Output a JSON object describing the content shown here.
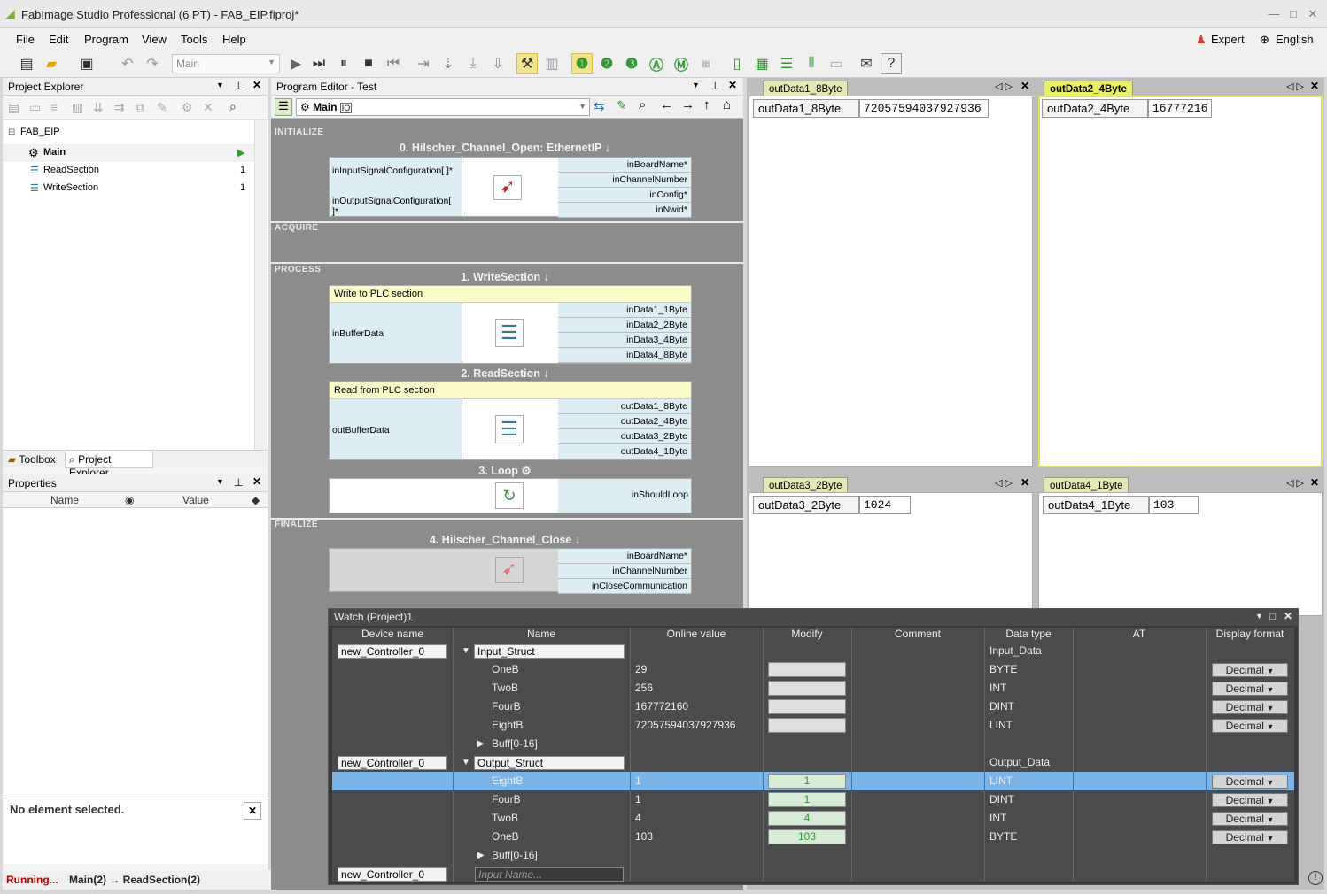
{
  "window": {
    "title": "FabImage Studio Professional (6 PT) - FAB_EIP.fiproj*"
  },
  "menu": {
    "items": [
      "File",
      "Edit",
      "Program",
      "View",
      "Tools",
      "Help"
    ],
    "expert": "Expert",
    "language": "English"
  },
  "toolbar": {
    "program_select": "Main"
  },
  "project_explorer": {
    "title": "Project Explorer",
    "root": "FAB_EIP",
    "items": [
      {
        "label": "Main",
        "count": ""
      },
      {
        "label": "ReadSection",
        "count": "1"
      },
      {
        "label": "WriteSection",
        "count": "1"
      }
    ],
    "tabs": [
      "Toolbox",
      "Project Explorer"
    ]
  },
  "properties": {
    "title": "Properties",
    "col_name": "Name",
    "col_value": "Value",
    "no_selection": "No element selected."
  },
  "status": {
    "running": "Running...",
    "path": "Main(2) → ReadSection(2)"
  },
  "program_editor": {
    "title": "Program Editor - Test",
    "program": "Main",
    "sections": {
      "initialize": "INITIALIZE",
      "acquire": "ACQUIRE",
      "process": "PROCESS",
      "finalize": "FINALIZE"
    },
    "block0": {
      "title": "0. Hilscher_Channel_Open: EthernetIP",
      "inputs": [
        "inInputSignalConfiguration[ ]*",
        "inOutputSignalConfiguration[ ]*"
      ],
      "outputs": [
        "inBoardName*",
        "inChannelNumber",
        "inConfig*",
        "inNwid*"
      ]
    },
    "block1": {
      "title": "1. WriteSection",
      "note": "Write to PLC section",
      "input": "inBufferData",
      "outputs": [
        "inData1_1Byte",
        "inData2_2Byte",
        "inData3_4Byte",
        "inData4_8Byte"
      ]
    },
    "block2": {
      "title": "2. ReadSection",
      "note": "Read from PLC section",
      "input": "outBufferData",
      "outputs": [
        "outData1_8Byte",
        "outData2_4Byte",
        "outData3_2Byte",
        "outData4_1Byte"
      ]
    },
    "block3": {
      "title": "3. Loop",
      "output": "inShouldLoop"
    },
    "block4": {
      "title": "4. Hilscher_Channel_Close",
      "outputs": [
        "inBoardName*",
        "inChannelNumber",
        "inCloseCommunication"
      ]
    }
  },
  "previews": [
    {
      "tab": "outData1_8Byte",
      "label": "outData1_8Byte",
      "value": "72057594037927936"
    },
    {
      "tab": "outData2_4Byte",
      "label": "outData2_4Byte",
      "value": "16777216"
    },
    {
      "tab": "outData3_2Byte",
      "label": "outData3_2Byte",
      "value": "1024"
    },
    {
      "tab": "outData4_1Byte",
      "label": "outData4_1Byte",
      "value": "103"
    }
  ],
  "watch": {
    "title": "Watch (Project)1",
    "columns": [
      "Device name",
      "Name",
      "Online value",
      "Modify",
      "Comment",
      "Data type",
      "AT",
      "Display format"
    ],
    "rows": [
      {
        "device": "new_Controller_0",
        "name": "Input_Struct",
        "value": "",
        "modify": "",
        "type": "Input_Data",
        "fmt": ""
      },
      {
        "device": "",
        "name": "OneB",
        "value": "29",
        "modify": "",
        "type": "BYTE",
        "fmt": "Decimal"
      },
      {
        "device": "",
        "name": "TwoB",
        "value": "256",
        "modify": "",
        "type": "INT",
        "fmt": "Decimal"
      },
      {
        "device": "",
        "name": "FourB",
        "value": "167772160",
        "modify": "",
        "type": "DINT",
        "fmt": "Decimal"
      },
      {
        "device": "",
        "name": "EightB",
        "value": "72057594037927936",
        "modify": "",
        "type": "LINT",
        "fmt": "Decimal"
      },
      {
        "device": "",
        "name": "Buff[0-16]",
        "value": "",
        "modify": "",
        "type": "",
        "fmt": ""
      },
      {
        "device": "new_Controller_0",
        "name": "Output_Struct",
        "value": "",
        "modify": "",
        "type": "Output_Data",
        "fmt": ""
      },
      {
        "device": "",
        "name": "EightB",
        "value": "1",
        "modify": "1",
        "type": "LINT",
        "fmt": "Decimal"
      },
      {
        "device": "",
        "name": "FourB",
        "value": "1",
        "modify": "1",
        "type": "DINT",
        "fmt": "Decimal"
      },
      {
        "device": "",
        "name": "TwoB",
        "value": "4",
        "modify": "4",
        "type": "INT",
        "fmt": "Decimal"
      },
      {
        "device": "",
        "name": "OneB",
        "value": "103",
        "modify": "103",
        "type": "BYTE",
        "fmt": "Decimal"
      },
      {
        "device": "",
        "name": "Buff[0-16]",
        "value": "",
        "modify": "",
        "type": "",
        "fmt": ""
      },
      {
        "device": "new_Controller_0",
        "name": "",
        "value": "",
        "modify": "",
        "type": "",
        "fmt": ""
      }
    ],
    "input_placeholder": "Input Name..."
  }
}
